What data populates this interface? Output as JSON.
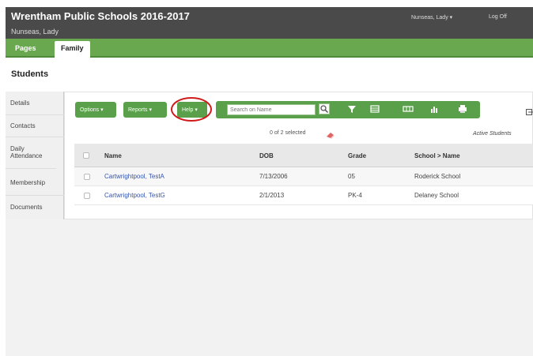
{
  "header": {
    "school_name": "Wrentham Public Schools 2016-2017",
    "user_name": "Nunseas, Lady",
    "user_menu": "Nunseas, Lady ▾",
    "logoff": "Log Off"
  },
  "tabs": [
    {
      "label": "Pages"
    },
    {
      "label": "Family"
    }
  ],
  "page_title": "Students",
  "sidenav": {
    "items": [
      {
        "label": "Details"
      },
      {
        "label": "Contacts"
      },
      {
        "label": "Daily Attendance"
      },
      {
        "label": "Membership"
      },
      {
        "label": "Documents"
      }
    ]
  },
  "toolbar": {
    "options_label": "Options ▾",
    "reports_label": "Reports ▾",
    "help_label": "Help ▾",
    "search_placeholder": "Search on Name"
  },
  "list": {
    "selected_count": "0 of 2 selected",
    "filter_label": "Active Students",
    "columns": [
      "Name",
      "DOB",
      "Grade",
      "School > Name"
    ],
    "rows": [
      {
        "name": "Cartwrightpool, TestA",
        "dob": "7/13/2006",
        "grade": "05",
        "school": "Roderick School"
      },
      {
        "name": "Cartwrightpool, TestG",
        "dob": "2/1/2013",
        "grade": "PK-4",
        "school": "Delaney School"
      }
    ]
  },
  "colors": {
    "accent_green": "#5aa04a",
    "header_dark": "#4a4a4a",
    "help_highlight": "#d01a1a",
    "link_blue": "#3355aa"
  },
  "icons": [
    "search-icon",
    "filter-icon",
    "grid-view-icon",
    "columns-icon",
    "chart-icon",
    "print-icon",
    "eraser-icon",
    "export-icon"
  ]
}
